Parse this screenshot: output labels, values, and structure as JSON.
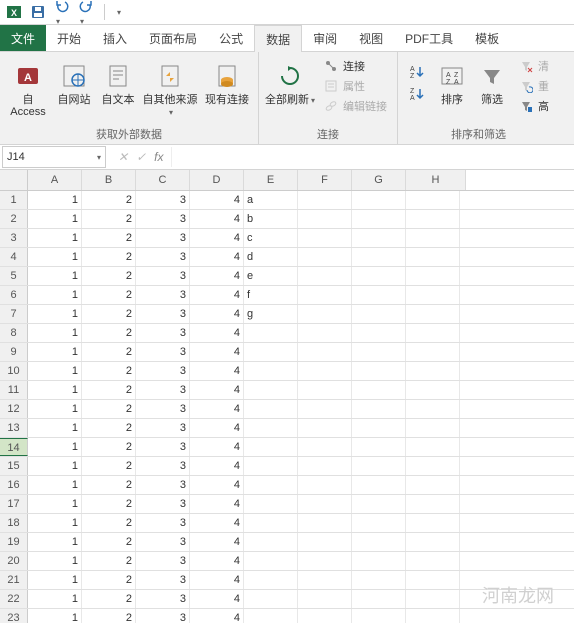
{
  "qat": {
    "save": "save",
    "undo": "undo",
    "redo": "redo"
  },
  "tabs": {
    "file": "文件",
    "items": [
      "开始",
      "插入",
      "页面布局",
      "公式",
      "数据",
      "审阅",
      "视图",
      "PDF工具",
      "模板"
    ],
    "active_index": 4
  },
  "ribbon": {
    "group_data": {
      "label": "获取外部数据",
      "access": "自 Access",
      "web": "自网站",
      "text": "自文本",
      "other": "自其他来源",
      "existing": "现有连接"
    },
    "group_conn": {
      "label": "连接",
      "refresh": "全部刷新",
      "connections": "连接",
      "properties": "属性",
      "editlinks": "编辑链接"
    },
    "group_sort": {
      "label": "排序和筛选",
      "sort": "排序",
      "filter": "筛选",
      "clear": "清",
      "reapply": "重",
      "advanced": "高"
    }
  },
  "namebox": {
    "value": "J14",
    "fx": "fx"
  },
  "columns": [
    "A",
    "B",
    "C",
    "D",
    "E",
    "F",
    "G",
    "H"
  ],
  "selected_row": 14,
  "rows": [
    {
      "n": 1,
      "v": [
        1,
        2,
        3,
        4,
        "a",
        "",
        "",
        ""
      ]
    },
    {
      "n": 2,
      "v": [
        1,
        2,
        3,
        4,
        "b",
        "",
        "",
        ""
      ]
    },
    {
      "n": 3,
      "v": [
        1,
        2,
        3,
        4,
        "c",
        "",
        "",
        ""
      ]
    },
    {
      "n": 4,
      "v": [
        1,
        2,
        3,
        4,
        "d",
        "",
        "",
        ""
      ]
    },
    {
      "n": 5,
      "v": [
        1,
        2,
        3,
        4,
        "e",
        "",
        "",
        ""
      ]
    },
    {
      "n": 6,
      "v": [
        1,
        2,
        3,
        4,
        "f",
        "",
        "",
        ""
      ]
    },
    {
      "n": 7,
      "v": [
        1,
        2,
        3,
        4,
        "g",
        "",
        "",
        ""
      ]
    },
    {
      "n": 8,
      "v": [
        1,
        2,
        3,
        4,
        "",
        "",
        "",
        ""
      ]
    },
    {
      "n": 9,
      "v": [
        1,
        2,
        3,
        4,
        "",
        "",
        "",
        ""
      ]
    },
    {
      "n": 10,
      "v": [
        1,
        2,
        3,
        4,
        "",
        "",
        "",
        ""
      ]
    },
    {
      "n": 11,
      "v": [
        1,
        2,
        3,
        4,
        "",
        "",
        "",
        ""
      ]
    },
    {
      "n": 12,
      "v": [
        1,
        2,
        3,
        4,
        "",
        "",
        "",
        ""
      ]
    },
    {
      "n": 13,
      "v": [
        1,
        2,
        3,
        4,
        "",
        "",
        "",
        ""
      ]
    },
    {
      "n": 14,
      "v": [
        1,
        2,
        3,
        4,
        "",
        "",
        "",
        ""
      ]
    },
    {
      "n": 15,
      "v": [
        1,
        2,
        3,
        4,
        "",
        "",
        "",
        ""
      ]
    },
    {
      "n": 16,
      "v": [
        1,
        2,
        3,
        4,
        "",
        "",
        "",
        ""
      ]
    },
    {
      "n": 17,
      "v": [
        1,
        2,
        3,
        4,
        "",
        "",
        "",
        ""
      ]
    },
    {
      "n": 18,
      "v": [
        1,
        2,
        3,
        4,
        "",
        "",
        "",
        ""
      ]
    },
    {
      "n": 19,
      "v": [
        1,
        2,
        3,
        4,
        "",
        "",
        "",
        ""
      ]
    },
    {
      "n": 20,
      "v": [
        1,
        2,
        3,
        4,
        "",
        "",
        "",
        ""
      ]
    },
    {
      "n": 21,
      "v": [
        1,
        2,
        3,
        4,
        "",
        "",
        "",
        ""
      ]
    },
    {
      "n": 22,
      "v": [
        1,
        2,
        3,
        4,
        "",
        "",
        "",
        ""
      ]
    },
    {
      "n": 23,
      "v": [
        1,
        2,
        3,
        4,
        "",
        "",
        "",
        ""
      ]
    }
  ],
  "watermark": "河南龙网"
}
